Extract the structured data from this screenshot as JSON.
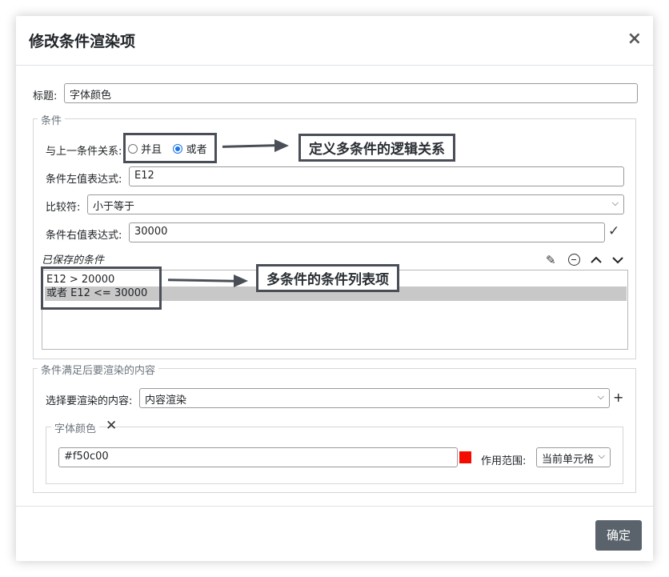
{
  "modal": {
    "title": "修改条件渲染项",
    "close_label": "×",
    "confirm_label": "确定"
  },
  "title_field": {
    "label": "标题:",
    "value": "字体颜色"
  },
  "condition_section": {
    "legend": "条件",
    "relation_label": "与上一条件关系:",
    "relation_options": [
      {
        "label": "并且",
        "checked": false
      },
      {
        "label": "或者",
        "checked": true
      }
    ],
    "left_expr_label": "条件左值表达式:",
    "left_expr_value": "E12",
    "operator_label": "比较符:",
    "operator_value": "小于等于",
    "right_expr_label": "条件右值表达式:",
    "right_expr_value": "30000",
    "saved_label": "已保存的条件",
    "saved_conditions": [
      {
        "text": "E12 > 20000",
        "selected": false
      },
      {
        "text": "或者 E12 <= 30000",
        "selected": true
      }
    ]
  },
  "annotations": {
    "relation_note": "定义多条件的逻辑关系",
    "list_note": "多条件的条件列表项"
  },
  "render_section": {
    "legend": "条件满足后要渲染的内容",
    "select_label": "选择要渲染的内容:",
    "select_value": "内容渲染",
    "add_label": "+",
    "font_color": {
      "legend": "字体颜色",
      "remove_label": "✕",
      "value": "#f50c00",
      "swatch_color": "#f50c00",
      "scope_label": "作用范围:",
      "scope_value": "当前单元格"
    }
  },
  "icons": {
    "edit": "pencil-icon",
    "remove": "minus-circle-icon",
    "up": "chevron-up-icon",
    "down": "chevron-down-icon",
    "apply": "check-icon"
  }
}
